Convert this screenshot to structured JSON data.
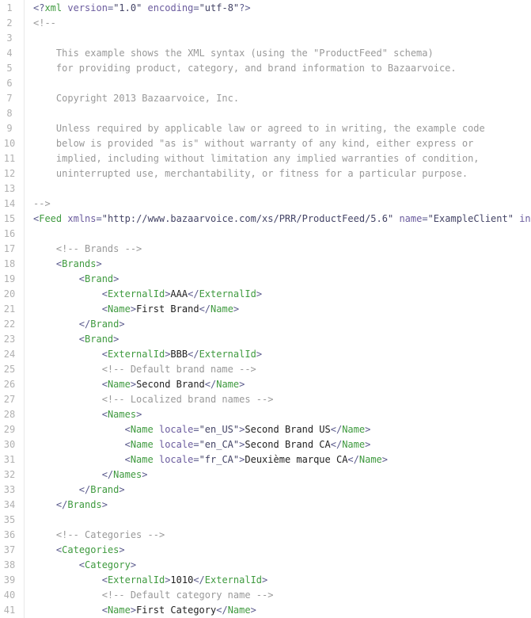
{
  "colors": {
    "tag": "#3f9a3f",
    "attribute": "#6b5c9e",
    "bracket": "#5a5a8c",
    "comment": "#999999",
    "line_number": "#b0b0b0",
    "text": "#222222"
  },
  "lines": [
    "<?xml version=\"1.0\" encoding=\"utf-8\"?>",
    "<!--",
    "",
    "    This example shows the XML syntax (using the \"ProductFeed\" schema)",
    "    for providing product, category, and brand information to Bazaarvoice.",
    "",
    "    Copyright 2013 Bazaarvoice, Inc.",
    "",
    "    Unless required by applicable law or agreed to in writing, the example code",
    "    below is provided \"as is\" without warranty of any kind, either express or",
    "    implied, including without limitation any implied warranties of condition,",
    "    uninterrupted use, merchantability, or fitness for a particular purpose.",
    "",
    "-->",
    "<Feed xmlns=\"http://www.bazaarvoice.com/xs/PRR/ProductFeed/5.6\" name=\"ExampleClient\" in",
    "",
    "    <!-- Brands -->",
    "    <Brands>",
    "        <Brand>",
    "            <ExternalId>AAA</ExternalId>",
    "            <Name>First Brand</Name>",
    "        </Brand>",
    "        <Brand>",
    "            <ExternalId>BBB</ExternalId>",
    "            <!-- Default brand name -->",
    "            <Name>Second Brand</Name>",
    "            <!-- Localized brand names -->",
    "            <Names>",
    "                <Name locale=\"en_US\">Second Brand US</Name>",
    "                <Name locale=\"en_CA\">Second Brand CA</Name>",
    "                <Name locale=\"fr_CA\">Deuxième marque CA</Name>",
    "            </Names>",
    "        </Brand>",
    "    </Brands>",
    "",
    "    <!-- Categories -->",
    "    <Categories>",
    "        <Category>",
    "            <ExternalId>1010</ExternalId>",
    "            <!-- Default category name -->",
    "            <Name>First Category</Name>"
  ]
}
